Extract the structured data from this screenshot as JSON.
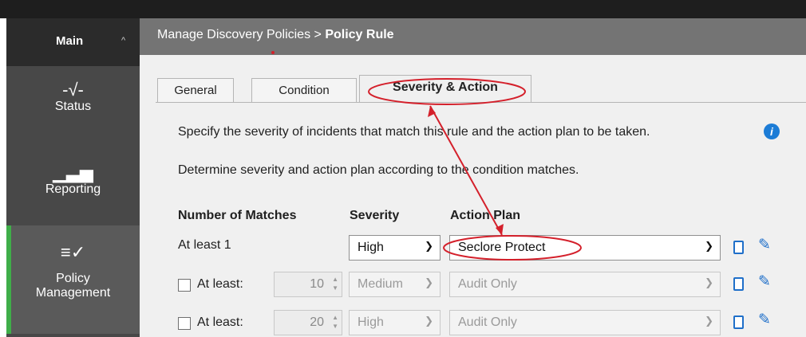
{
  "sidebar": {
    "main_label": "Main",
    "main_chevron": "^",
    "items": [
      {
        "label": "Status",
        "icon": "pulse-icon",
        "glyph": "-√‐"
      },
      {
        "label": "Reporting",
        "icon": "bar-chart-icon",
        "glyph": "▁▃▅"
      },
      {
        "label": "Policy",
        "label2": "Management",
        "icon": "policy-list-icon",
        "glyph": "≡✓"
      }
    ]
  },
  "header": {
    "breadcrumb": "Manage Discovery Policies",
    "sep": " > ",
    "current": "Policy Rule"
  },
  "tabs": [
    "General",
    "Condition",
    "Severity & Action"
  ],
  "description1": "Specify the severity of incidents that match this rule and the action plan to be taken.",
  "description2": "Determine severity and action plan according to the condition matches.",
  "info_glyph": "i",
  "table": {
    "headers": [
      "Number of Matches",
      "Severity",
      "Action Plan"
    ],
    "rows": [
      {
        "label": "At least 1",
        "severity": "High",
        "action": "Seclore Protect"
      },
      {
        "label": "At least:",
        "count": "10",
        "severity": "Medium",
        "action": "Audit Only"
      },
      {
        "label": "At least:",
        "count": "20",
        "severity": "High",
        "action": "Audit Only"
      }
    ]
  },
  "colors": {
    "accent": "#3fae49",
    "annotation": "#d4202b",
    "link": "#1f6fc9"
  }
}
